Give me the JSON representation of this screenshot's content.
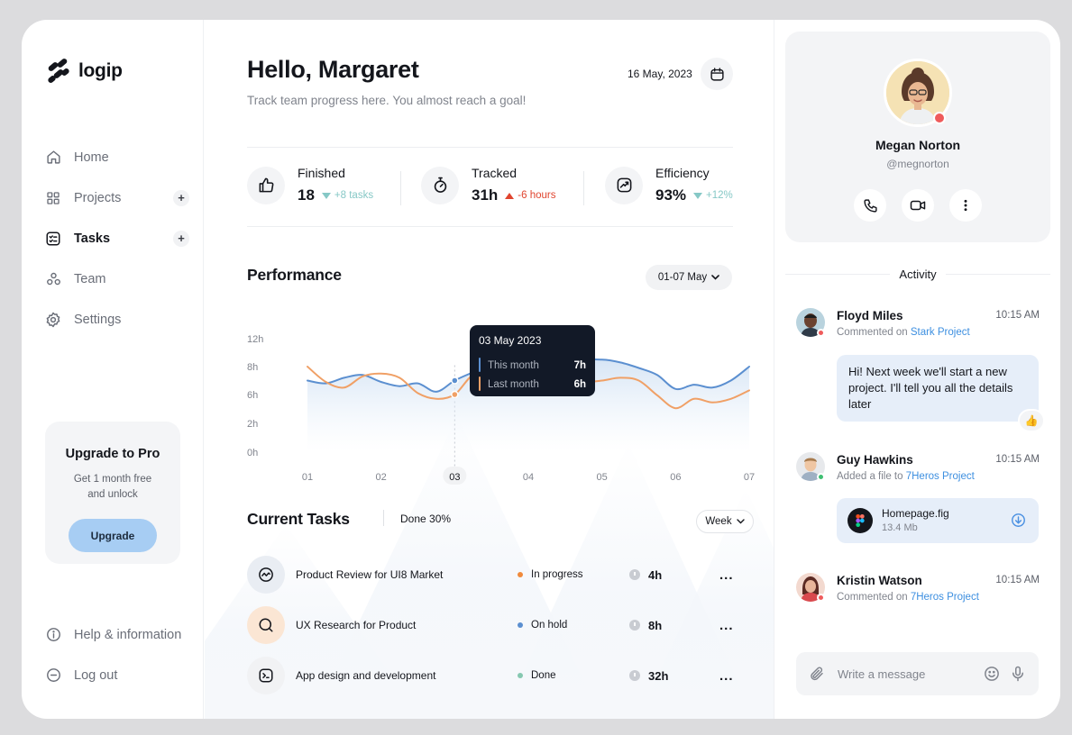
{
  "brand": {
    "name": "logip"
  },
  "sidebar": {
    "items": [
      {
        "label": "Home",
        "icon": "home-icon",
        "active": false,
        "has_plus": false
      },
      {
        "label": "Projects",
        "icon": "grid-icon",
        "active": false,
        "has_plus": true
      },
      {
        "label": "Tasks",
        "icon": "checklist-icon",
        "active": true,
        "has_plus": true
      },
      {
        "label": "Team",
        "icon": "team-icon",
        "active": false,
        "has_plus": false
      },
      {
        "label": "Settings",
        "icon": "gear-icon",
        "active": false,
        "has_plus": false
      }
    ],
    "plus_label": "+",
    "upgrade": {
      "title": "Upgrade to Pro",
      "subtitle": "Get 1 month free and unlock",
      "button": "Upgrade"
    },
    "bottom": [
      {
        "label": "Help & information",
        "icon": "info-icon"
      },
      {
        "label": "Log out",
        "icon": "logout-icon"
      }
    ]
  },
  "header": {
    "greeting": "Hello, Margaret",
    "subtitle": "Track team progress here. You almost reach a goal!",
    "date": "16 May, 2023"
  },
  "stats": [
    {
      "label": "Finished",
      "value": "18",
      "delta": "+8 tasks",
      "trend": "up",
      "icon": "thumbs-up-icon"
    },
    {
      "label": "Tracked",
      "value": "31h",
      "delta": "-6 hours",
      "trend": "down",
      "icon": "stopwatch-icon"
    },
    {
      "label": "Efficiency",
      "value": "93%",
      "delta": "+12%",
      "trend": "up",
      "icon": "trend-chart-icon"
    }
  ],
  "performance": {
    "title": "Performance",
    "range": "01-07 May"
  },
  "chart_data": {
    "type": "area",
    "title": "Performance",
    "categories": [
      "01",
      "02",
      "03",
      "04",
      "05",
      "06",
      "07"
    ],
    "highlighted_category": "03",
    "y_ticks": [
      "0h",
      "2h",
      "6h",
      "8h",
      "12h"
    ],
    "series": [
      {
        "name": "This month",
        "color": "#5b8fd0",
        "x": [
          1,
          1.25,
          1.5,
          1.75,
          2,
          2.25,
          2.5,
          2.75,
          3,
          3.25,
          3.5,
          3.75,
          4,
          4.25,
          4.5,
          4.75,
          5,
          5.25,
          5.5,
          5.75,
          6,
          6.25,
          6.5,
          6.75,
          7
        ],
        "values": [
          7.0,
          6.8,
          7.2,
          7.4,
          6.9,
          6.6,
          6.8,
          6.2,
          7.0,
          7.6,
          8.4,
          8.6,
          7.7,
          6.8,
          7.6,
          8.8,
          9.0,
          8.6,
          7.9,
          7.4,
          6.4,
          6.7,
          6.5,
          7.0,
          8.0
        ]
      },
      {
        "name": "Last month",
        "color": "#f0a066",
        "x": [
          1,
          1.25,
          1.5,
          1.75,
          2,
          2.25,
          2.5,
          2.75,
          3,
          3.25,
          3.5,
          3.75,
          4,
          4.25,
          4.5,
          4.75,
          5,
          5.25,
          5.5,
          5.75,
          6,
          6.25,
          6.5,
          6.75,
          7
        ],
        "values": [
          8.0,
          6.9,
          6.5,
          7.3,
          7.5,
          7.2,
          6.1,
          5.4,
          6.0,
          7.4,
          7.3,
          6.5,
          6.7,
          7.3,
          7.1,
          6.9,
          7.0,
          7.2,
          7.0,
          5.9,
          4.1,
          5.4,
          4.9,
          5.4,
          6.3
        ]
      }
    ],
    "tooltip": {
      "date": "03 May 2023",
      "rows": [
        {
          "label": "This month",
          "value": "7h",
          "color": "#5b8fd0"
        },
        {
          "label": "Last month",
          "value": "6h",
          "color": "#f0a066"
        }
      ]
    }
  },
  "tasks": {
    "title": "Current Tasks",
    "done": "Done 30%",
    "period": "Week",
    "items": [
      {
        "name": "Product Review for UI8 Market",
        "status": "In progress",
        "status_color": "#f08a3c",
        "time": "4h",
        "icon": "activity-icon",
        "icon_bg": "#e9edf3"
      },
      {
        "name": "UX Research for Product",
        "status": "On hold",
        "status_color": "#5b8fd0",
        "time": "8h",
        "icon": "search-icon",
        "icon_bg": "#fbe6d4"
      },
      {
        "name": "App design and development",
        "status": "Done",
        "status_color": "#86c8b0",
        "time": "32h",
        "icon": "terminal-icon",
        "icon_bg": "#f1f2f4"
      }
    ],
    "more": "..."
  },
  "profile": {
    "name": "Megan Norton",
    "handle": "@megnorton",
    "status_color": "#ef5b5b"
  },
  "activity": {
    "title": "Activity",
    "items": [
      {
        "name": "Floyd Miles",
        "time": "10:15 AM",
        "action": "Commented on",
        "target": "Stark Project",
        "dot": "#ef5b5b"
      },
      {
        "name": "Guy Hawkins",
        "time": "10:15 AM",
        "action": "Added a file to",
        "target": "7Heros Project",
        "dot": "#3fbf72"
      },
      {
        "name": "Kristin Watson",
        "time": "10:15 AM",
        "action": "Commented on",
        "target": "7Heros Project",
        "dot": "#ef5b5b"
      }
    ],
    "message": "Hi! Next week we'll start a new project. I'll tell you all the details later",
    "reaction": "👍",
    "file": {
      "name": "Homepage.fig",
      "size": "13.4 Mb"
    }
  },
  "composer": {
    "placeholder": "Write a message"
  },
  "colors": {
    "accent": "#5b8fd0",
    "orange": "#f0a066",
    "dark": "#121927"
  }
}
